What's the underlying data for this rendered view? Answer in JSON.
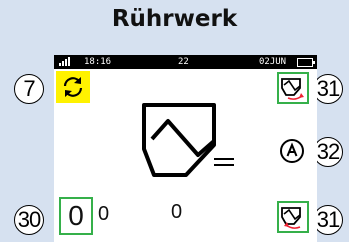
{
  "title": "Rührwerk",
  "statusbar": {
    "time": "18:16",
    "center": "22",
    "date": "02JUN"
  },
  "counters": {
    "primary": "0",
    "secondary": "0",
    "center": "0"
  },
  "callouts": {
    "rotate": "7",
    "top_right": "31",
    "auto": "32",
    "bottom_right": "31",
    "counter": "30"
  },
  "colors": {
    "background": "#d6e1f0",
    "highlight": "#fff200",
    "frame": "#35b04a"
  },
  "icons": {
    "rotate": "rotate-arrows-icon",
    "mixer": "mixer-tank-icon",
    "tilt_up": "tilt-up-icon",
    "auto": "auto-mode-icon",
    "tilt_down": "tilt-down-icon"
  }
}
